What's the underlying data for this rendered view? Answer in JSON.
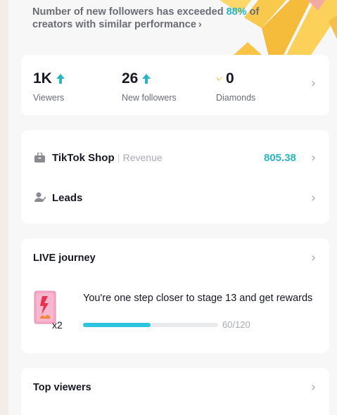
{
  "banner": {
    "text_before": "Number of new followers has exceeded ",
    "percent": "88%",
    "text_after": " of creators with similar performance",
    "chevron": "›"
  },
  "stats": [
    {
      "value": "1K",
      "label": "Viewers",
      "icon": "arrow-up-icon"
    },
    {
      "value": "26",
      "label": "New followers",
      "icon": "arrow-up-icon"
    },
    {
      "value": "0",
      "label": "Diamonds",
      "icon": "diamond-icon"
    }
  ],
  "shop": {
    "title": "TikTok Shop",
    "separator": "|",
    "sub": "Revenue",
    "value": "805.38"
  },
  "leads": {
    "title": "Leads"
  },
  "journey": {
    "title": "LIVE journey",
    "message": "You're one step closer to stage 13 and get rewards",
    "multiplier": "x2",
    "progress_text": "60/120",
    "progress_fraction": 0.5
  },
  "top_viewers": {
    "title": "Top viewers"
  },
  "colors": {
    "accent": "#2bb5c3",
    "progress": "#2bc3e0",
    "banner_rays": "#f6c64a"
  }
}
